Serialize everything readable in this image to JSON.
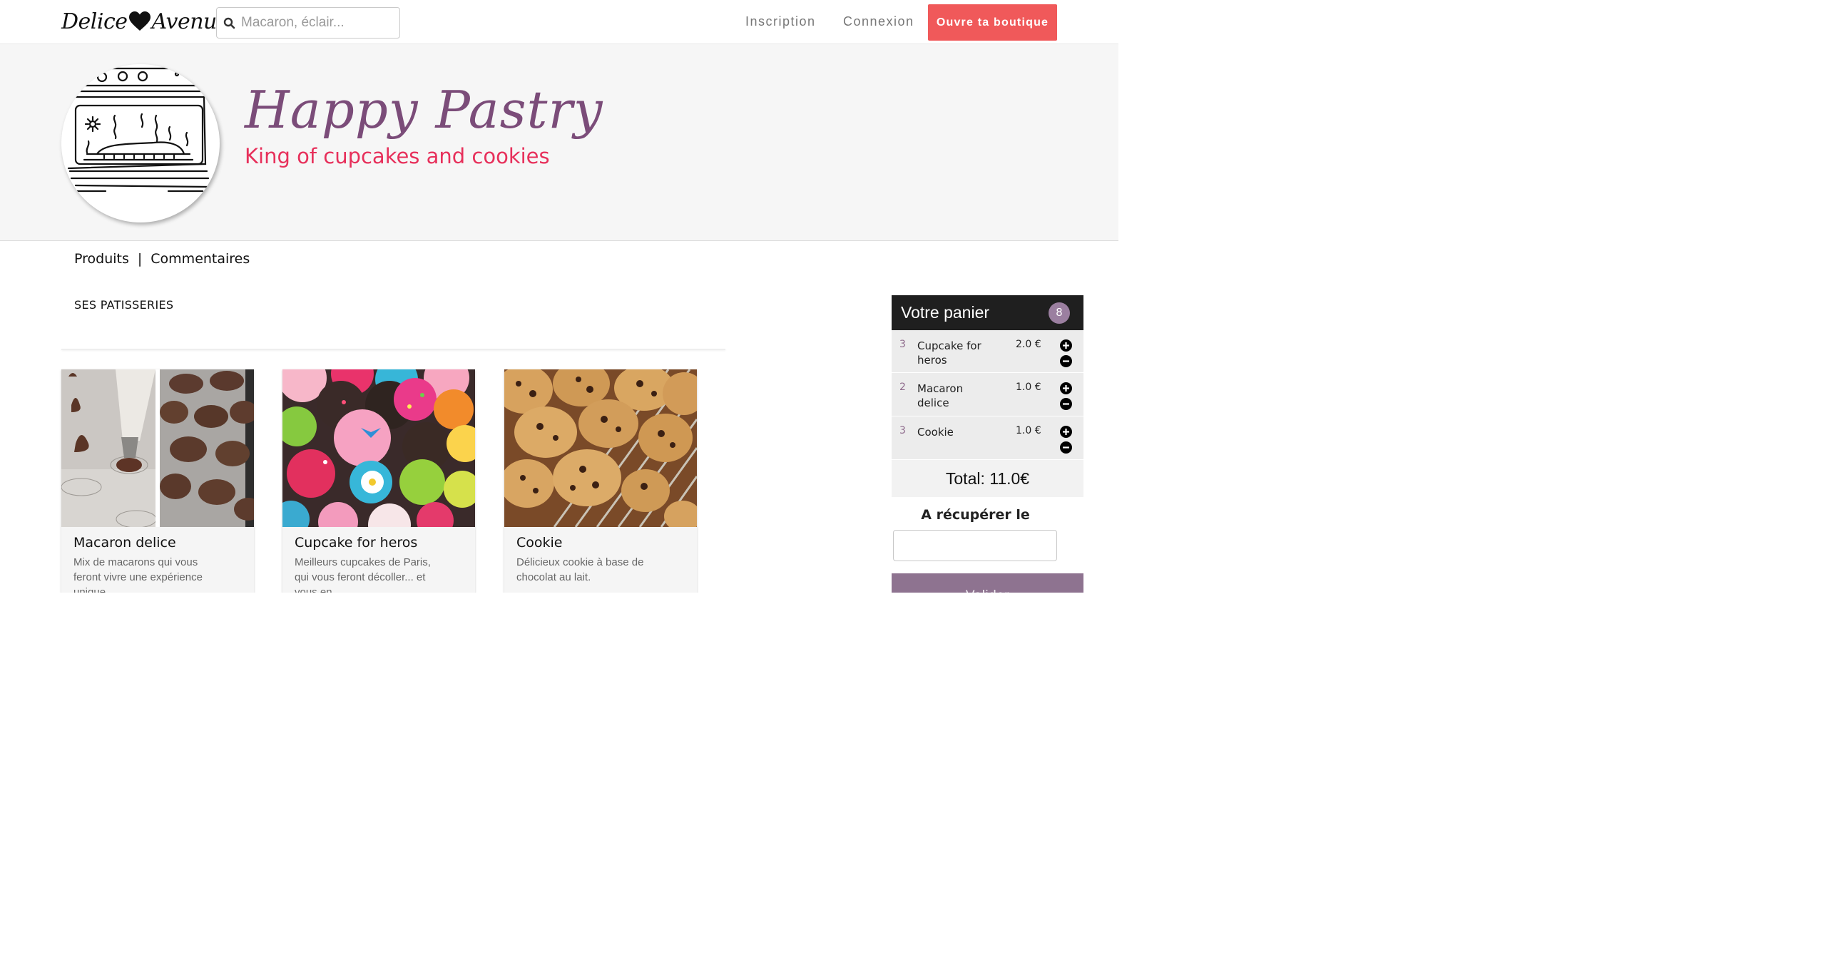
{
  "header": {
    "logo_left": "Delice",
    "logo_right": "Avenue",
    "search_placeholder": "Macaron, éclair...",
    "nav_inscription": "Inscription",
    "nav_connexion": "Connexion",
    "cta_label": "Ouvre ta boutique"
  },
  "shop": {
    "name": "Happy Pastry",
    "tagline": "King of cupcakes and cookies"
  },
  "tabs": {
    "produits": "Produits",
    "separator": "|",
    "commentaires": "Commentaires"
  },
  "section_title": "SES PATISSERIES",
  "products": [
    {
      "title": "Macaron delice",
      "description": "Mix de macarons qui vous feront vivre une expérience unique"
    },
    {
      "title": "Cupcake for heros",
      "description": "Meilleurs cupcakes de Paris, qui vous feront décoller... et vous en"
    },
    {
      "title": "Cookie",
      "description": "Délicieux cookie à base de chocolat au lait."
    }
  ],
  "cart": {
    "title": "Votre panier",
    "count": "8",
    "items": [
      {
        "qty": "3",
        "name": "Cupcake for heros",
        "price": "2.0 €"
      },
      {
        "qty": "2",
        "name": "Macaron delice",
        "price": "1.0 €"
      },
      {
        "qty": "3",
        "name": "Cookie",
        "price": "1.0 €"
      }
    ],
    "total": "Total: 11.0€",
    "pickup_label": "A récupérer le",
    "pickup_value": "",
    "submit_label": "Valider"
  },
  "colors": {
    "accent": "#f0595a",
    "shop_name": "#7b4c79",
    "tagline": "#e7305b",
    "cart_header": "#1f1f1f",
    "badge": "#9b7fa0",
    "submit": "#8e7390"
  }
}
